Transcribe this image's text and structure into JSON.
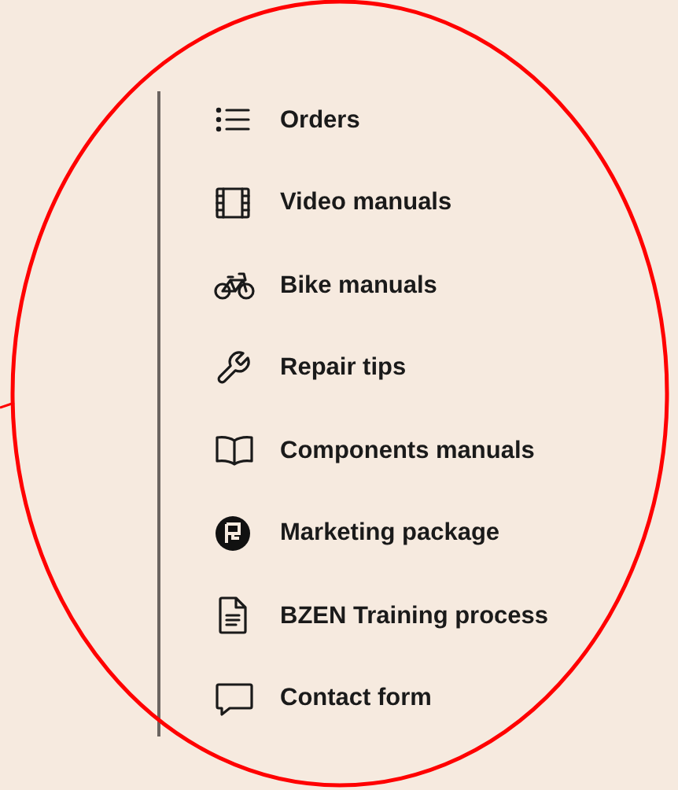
{
  "menu": {
    "items": [
      {
        "label": "Orders"
      },
      {
        "label": "Video manuals"
      },
      {
        "label": "Bike manuals"
      },
      {
        "label": "Repair tips"
      },
      {
        "label": "Components manuals"
      },
      {
        "label": "Marketing package"
      },
      {
        "label": "BZEN Training process"
      },
      {
        "label": "Contact form"
      }
    ]
  }
}
